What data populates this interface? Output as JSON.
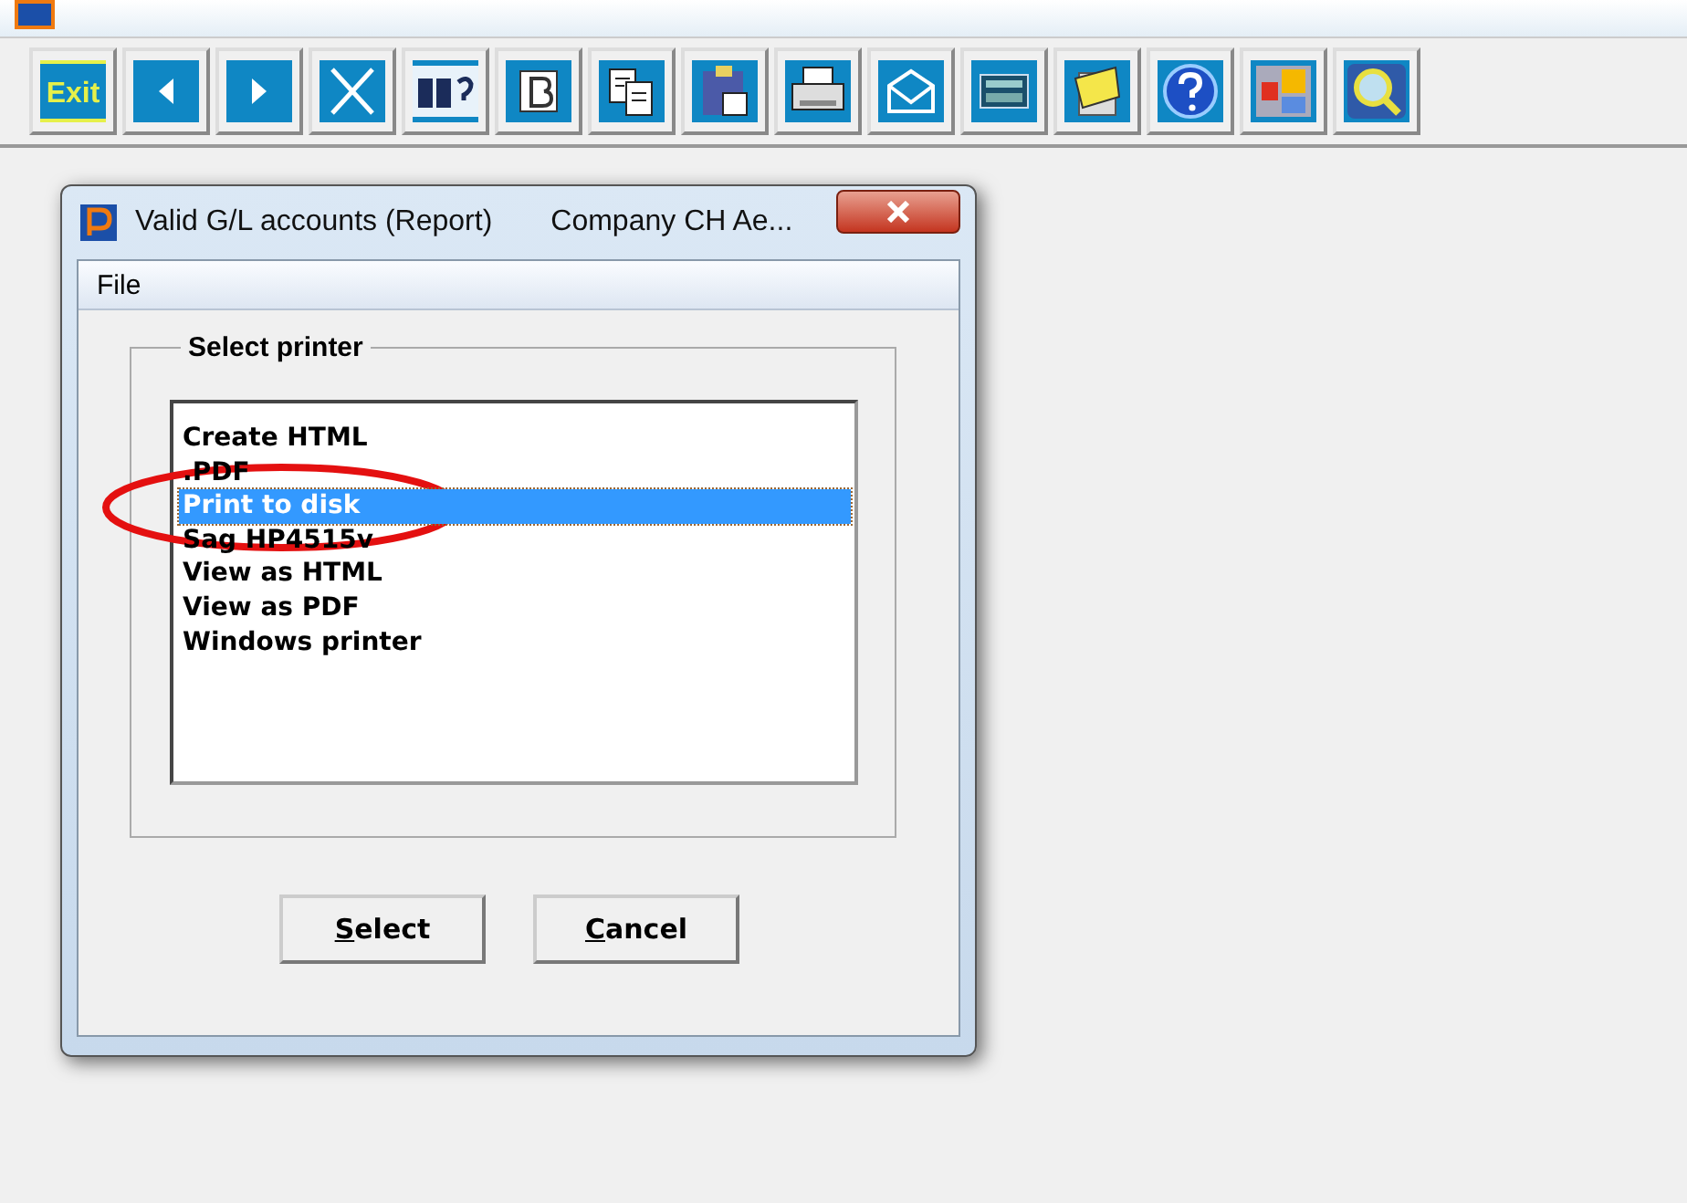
{
  "toolbar": {
    "exit_label": "Exit"
  },
  "dialog": {
    "title": "Valid G/L accounts (Report)",
    "company": "Company CH  Ae...",
    "menu": [
      "File"
    ],
    "group_label": "Select printer",
    "printers": [
      {
        "label": "Create HTML",
        "selected": false
      },
      {
        "label": ".PDF",
        "selected": false
      },
      {
        "label": "Print to disk",
        "selected": true
      },
      {
        "label": "Sag HP4515v",
        "selected": false
      },
      {
        "label": "View as HTML",
        "selected": false
      },
      {
        "label": "View as PDF",
        "selected": false
      },
      {
        "label": "Windows printer",
        "selected": false
      }
    ],
    "buttons": [
      {
        "accel": "S",
        "rest": "elect"
      },
      {
        "accel": "C",
        "rest": "ancel"
      }
    ]
  },
  "annotation": {
    "kind": "ellipse"
  }
}
